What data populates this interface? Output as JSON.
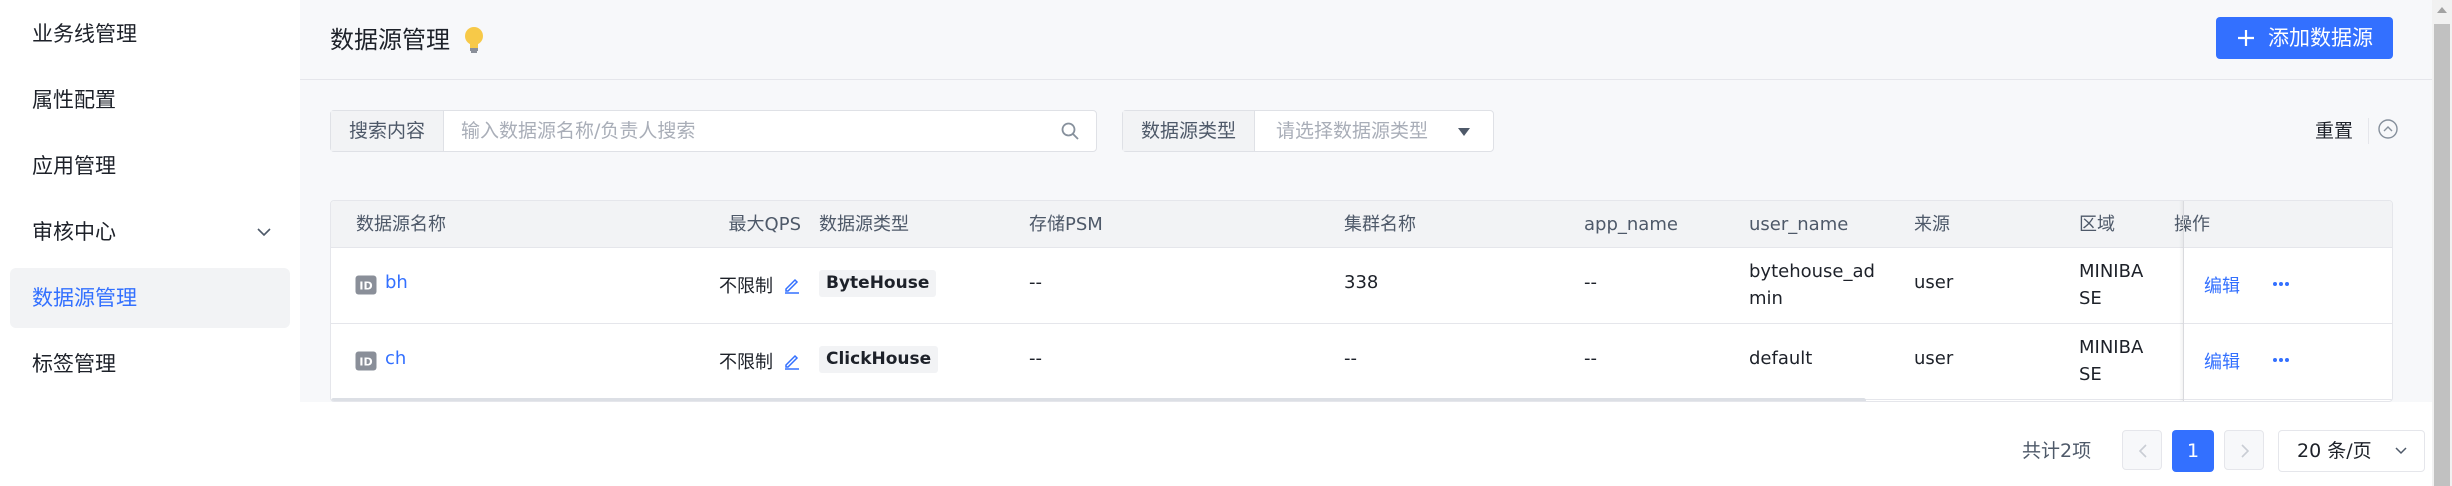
{
  "sidebar": {
    "items": [
      {
        "label": "业务线管理"
      },
      {
        "label": "属性配置"
      },
      {
        "label": "应用管理"
      },
      {
        "label": "审核中心"
      },
      {
        "label": "数据源管理"
      },
      {
        "label": "标签管理"
      }
    ],
    "active_index": 4
  },
  "header": {
    "title": "数据源管理",
    "add_button_label": "添加数据源"
  },
  "filters": {
    "search_label": "搜索内容",
    "search_placeholder": "输入数据源名称/负责人搜索",
    "type_label": "数据源类型",
    "type_placeholder": "请选择数据源类型",
    "reset_label": "重置"
  },
  "table": {
    "columns": [
      "数据源名称",
      "最大QPS",
      "数据源类型",
      "存储PSM",
      "集群名称",
      "app_name",
      "user_name",
      "来源",
      "区域",
      "操作"
    ],
    "rows": [
      {
        "name": "bh",
        "max_qps": "不限制",
        "type": "ByteHouse",
        "psm": "--",
        "cluster": "338",
        "app_name": "--",
        "user_name": "bytehouse_admin",
        "source": "user",
        "region": "MINIBASE",
        "action": "编辑"
      },
      {
        "name": "ch",
        "max_qps": "不限制",
        "type": "ClickHouse",
        "psm": "--",
        "cluster": "--",
        "app_name": "--",
        "user_name": "default",
        "source": "user",
        "region": "MINIBASE",
        "action": "编辑"
      }
    ]
  },
  "pagination": {
    "total_text": "共计2项",
    "current_page": "1",
    "page_size": "20 条/页"
  },
  "colors": {
    "primary": "#3370ff",
    "active_bg": "#f2f3f5",
    "bulb": "#f7c948"
  }
}
